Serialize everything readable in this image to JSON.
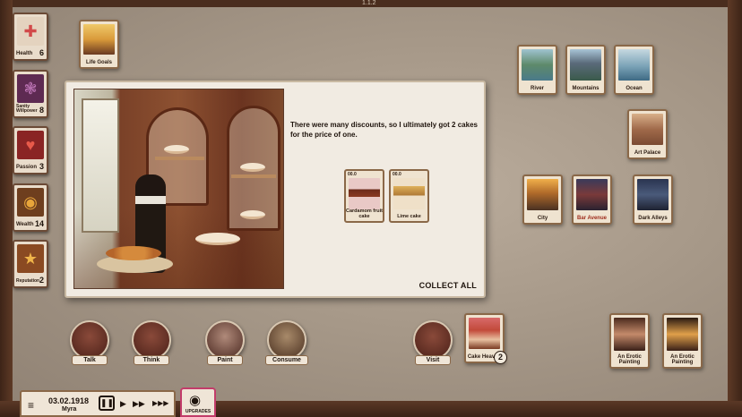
{
  "version": "1.1.2",
  "stats": [
    {
      "label": "Health",
      "value": "6",
      "icon": "red-cross-icon",
      "color": "#d24a4a"
    },
    {
      "label": "Sanity Willpower",
      "value": "8",
      "icon": "brain-icon",
      "color": "#8a3a78"
    },
    {
      "label": "Passion",
      "value": "3",
      "icon": "heart-icon",
      "color": "#b3282a"
    },
    {
      "label": "Wealth",
      "value": "14",
      "icon": "coin-eye-icon",
      "color": "#c98a2a"
    },
    {
      "label": "Reputation",
      "value": "2",
      "icon": "star-icon",
      "color": "#d49a3a"
    }
  ],
  "life_goals": {
    "label": "Life Goals"
  },
  "dialog": {
    "text": "There were many discounts, so I ultimately got 2 cakes for the price of one.",
    "collect_label": "COLLECT ALL",
    "rewards": [
      {
        "price": "00.0",
        "name": "Cardamom fruit cake"
      },
      {
        "price": "00.0",
        "name": "Lime cake"
      }
    ]
  },
  "places_top": [
    {
      "name": "River"
    },
    {
      "name": "Mountains"
    },
    {
      "name": "Ocean"
    }
  ],
  "art_palace": {
    "name": "Art Palace"
  },
  "places_mid": [
    {
      "name": "City"
    },
    {
      "name": "Bar Avenue"
    },
    {
      "name": "Dark Alleys"
    }
  ],
  "actions": [
    {
      "label": "Talk"
    },
    {
      "label": "Think"
    },
    {
      "label": "Paint"
    },
    {
      "label": "Consume"
    },
    {
      "label": "Visit"
    }
  ],
  "cake_card": {
    "name": "Cake Heaven",
    "count": "2"
  },
  "paintings": [
    {
      "name": "An Erotic Painting"
    },
    {
      "name": "An Erotic Painting"
    }
  ],
  "timebar": {
    "menu_icon": "≡",
    "date": "03.02.1918",
    "name": "Myra",
    "pause": "❚❚",
    "play": "▶",
    "fast": "▶▶",
    "faster": "▶▶▶"
  },
  "upgrades": {
    "label": "UPGRADES",
    "icon": "eye-icon"
  }
}
